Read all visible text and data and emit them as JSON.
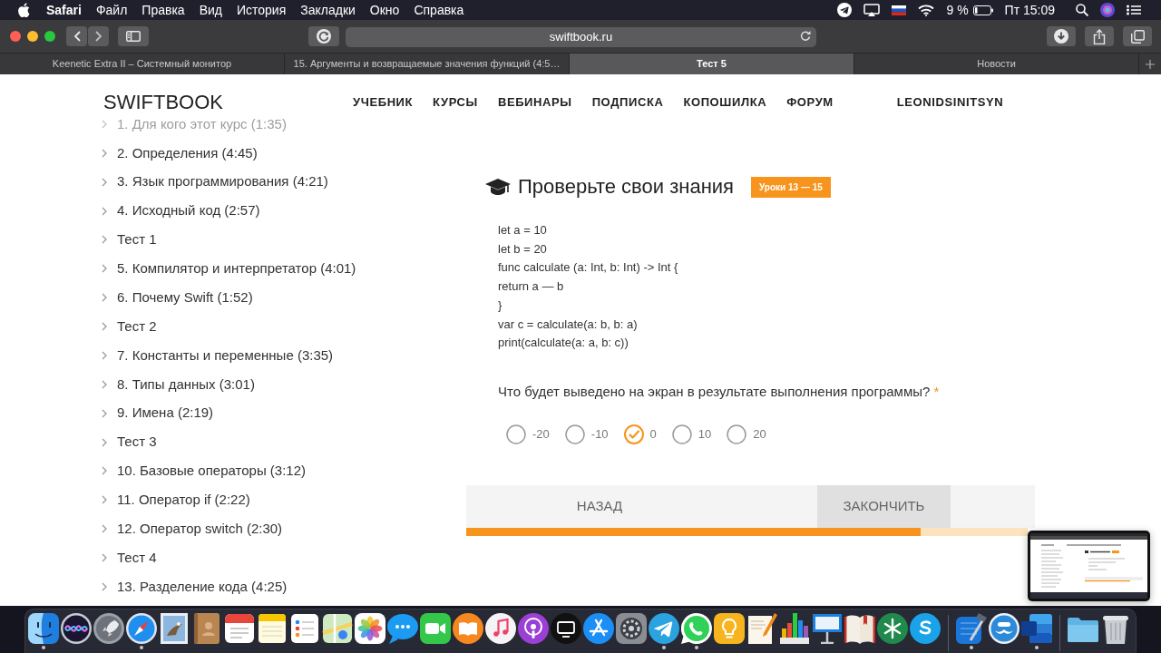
{
  "menu_bar": {
    "app": "Safari",
    "menus": [
      "Файл",
      "Правка",
      "Вид",
      "История",
      "Закладки",
      "Окно",
      "Справка"
    ],
    "battery": "9 %",
    "clock": "Пт 15:09"
  },
  "browser": {
    "address": "swiftbook.ru",
    "tabs": [
      {
        "title": "Keenetic Extra II – Системный монитор",
        "selected": false
      },
      {
        "title": "15. Аргументы и возвращаемые значения функций (4:5…",
        "selected": false
      },
      {
        "title": "Тест 5",
        "selected": true
      },
      {
        "title": "Новости",
        "selected": false
      }
    ]
  },
  "site_header": {
    "logo": "SWIFTBOOK",
    "nav": [
      "УЧЕБНИК",
      "КУРСЫ",
      "ВЕБИНАРЫ",
      "ПОДПИСКА",
      "КОПОШИЛКА",
      "ФОРУМ"
    ],
    "user": "LEONIDSINITSYN"
  },
  "lessons": [
    {
      "title": "1. Для кого этот курс (1:35)",
      "dimmed": true
    },
    {
      "title": "2. Определения (4:45)",
      "dimmed": false
    },
    {
      "title": "3. Язык программирования (4:21)",
      "dimmed": false
    },
    {
      "title": "4. Исходный код (2:57)",
      "dimmed": false
    },
    {
      "title": "Тест 1",
      "dimmed": false
    },
    {
      "title": "5. Компилятор и интерпретатор (4:01)",
      "dimmed": false
    },
    {
      "title": "6. Почему Swift (1:52)",
      "dimmed": false
    },
    {
      "title": "Тест 2",
      "dimmed": false
    },
    {
      "title": "7. Константы и переменные (3:35)",
      "dimmed": false
    },
    {
      "title": "8. Типы данных (3:01)",
      "dimmed": false
    },
    {
      "title": "9. Имена (2:19)",
      "dimmed": false
    },
    {
      "title": "Тест 3",
      "dimmed": false
    },
    {
      "title": "10. Базовые операторы (3:12)",
      "dimmed": false
    },
    {
      "title": "11. Оператор if (2:22)",
      "dimmed": false
    },
    {
      "title": "12. Оператор switch (2:30)",
      "dimmed": false
    },
    {
      "title": "Тест 4",
      "dimmed": false
    },
    {
      "title": "13. Разделение кода (4:25)",
      "dimmed": false
    }
  ],
  "quiz": {
    "title": "Проверьте свои знания",
    "badge": "Уроки 13 — 15",
    "code_lines": [
      "let a = 10",
      "let b = 20",
      "func calculate (a: Int, b: Int) -> Int {",
      "return a — b",
      "}",
      "var c = calculate(a: b, b: a)",
      "print(calculate(a: a, b: c))"
    ],
    "question": "Что будет выведено на экран в результате выполнения программы?",
    "required_mark": "*",
    "options": [
      {
        "label": "-20",
        "selected": false
      },
      {
        "label": "-10",
        "selected": false
      },
      {
        "label": "0",
        "selected": true
      },
      {
        "label": "10",
        "selected": false
      },
      {
        "label": "20",
        "selected": false
      }
    ],
    "buttons": {
      "back": "НАЗАД",
      "finish": "ЗАКОНЧИТЬ"
    },
    "progress": {
      "level": 0.81
    }
  },
  "dock": {
    "sections": [
      [
        {
          "running": true
        },
        {
          "running": false
        },
        {
          "running": false
        },
        {
          "running": true
        },
        {
          "running": false
        },
        {
          "running": false
        },
        {
          "running": false
        },
        {
          "running": false
        },
        {
          "running": false
        },
        {
          "running": false
        },
        {
          "running": false
        },
        {
          "running": false
        },
        {
          "running": false
        },
        {
          "running": false
        },
        {
          "running": false
        },
        {
          "running": false
        },
        {
          "running": false
        },
        {
          "running": false
        },
        {
          "running": false
        },
        {
          "running": true
        },
        {
          "running": true
        },
        {
          "running": false
        },
        {
          "running": false
        },
        {
          "running": false
        },
        {
          "running": false
        },
        {
          "running": false
        },
        {
          "running": false
        },
        {
          "running": false
        }
      ],
      [
        {
          "running": true
        },
        {
          "running": false
        },
        {
          "running": true
        }
      ],
      [
        {
          "running": false
        },
        {
          "running": false
        }
      ]
    ]
  }
}
